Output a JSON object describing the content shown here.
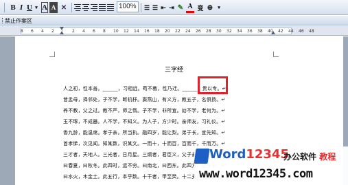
{
  "toolbar": {
    "bold": "B",
    "italic": "I",
    "underline": "U",
    "font_color_a": "A",
    "font_size": "abc",
    "highlight": "ab",
    "font_a": "A",
    "phonetic": "变",
    "circle": "⊕",
    "combo_value": "100%"
  },
  "bar2": {
    "label": "禁止作案区"
  },
  "ruler": {
    "ticks": [
      "8",
      "6",
      "4",
      "2",
      "",
      "2",
      "4",
      "6",
      "8",
      "10",
      "12",
      "14",
      "16",
      "18",
      "20",
      "22",
      "24",
      "26",
      "28",
      "30",
      "32",
      "34",
      "36",
      "38",
      "40",
      "42",
      "44",
      "46",
      "48"
    ]
  },
  "document": {
    "title": "三字经",
    "lines": [
      "人之初，性本善。______，习相远。苟不教，性乃迁。______，贵以专。↵",
      "昔孟母，择邻处，子不学，断机杼。窦燕山，有义方，教五子，名俱扬。↵",
      "养不教，父之过。教不严，师之惰。子不学，非所宜。幼不学，老何为。↵",
      "玉不琢，不成器。人不学，不知义。为人子，方少时。亲师友，习礼仪。↵",
      "香九龄，能温席。孝于亲，所当执。融四岁，能让梨。弟于长，宜先知。↵",
      "首孝悌，次见闻。知某数，识某文。一而十，十而百，百而千，千而万。↵",
      "三才者，天地人。三光者，日月星。三纲者，君臣义，父子亲，夫妇顺。↵",
      "曰春夏，曰秋冬。此四时，运不穷。曰南北，曰西东。此四方，应乎中。↵",
      "曰水火，木金土。此五行，本乎数。十干者，甲至癸。十二支，子至亥。↵"
    ]
  },
  "watermark": {
    "brand_a": "Word",
    "brand_b": "12345",
    "sub_a": "办公软件",
    "sub_b": "教程",
    "url": "www.word12345.com"
  },
  "colors": {
    "highlight_box": "#e0222a",
    "brand_blue": "#1f5fb8",
    "brand_red": "#e53131"
  }
}
